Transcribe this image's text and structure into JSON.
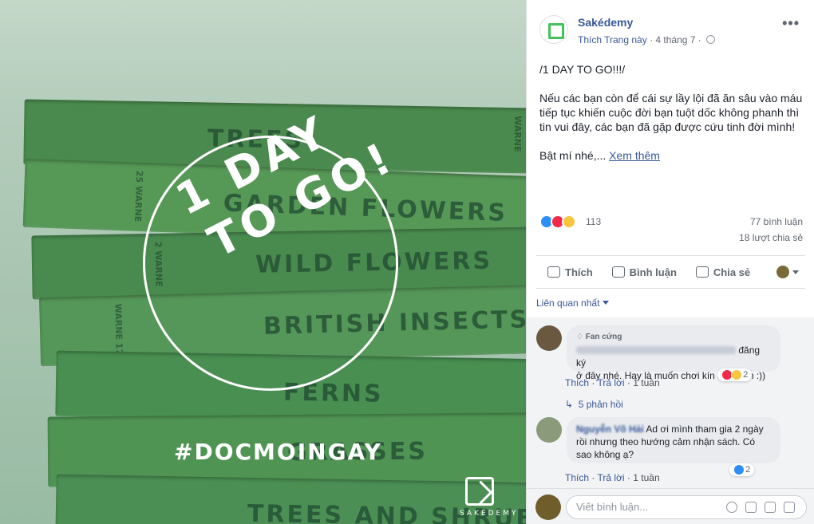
{
  "image": {
    "titles": [
      "TREES",
      "GARDEN FLOWERS",
      "WILD FLOWERS",
      "BRITISH INSECTS",
      "FERNS",
      "GRASSES",
      "TREES AND SHRUBS"
    ],
    "spine_text": [
      "WARNE",
      "25 WARNE",
      "2 WARNE",
      "WARNE 17"
    ],
    "headline_line1": "1 DAY",
    "headline_line2": "TO GO!",
    "hashtag": "#DOCMOINGAY",
    "brand": "SAKÉDEMY"
  },
  "post": {
    "page_name": "Sakédemy",
    "like_page": "Thích Trang này",
    "separator": "·",
    "date": "4 tháng 7",
    "separator2": "·",
    "more": "•••",
    "lines": [
      "/1 DAY TO GO!!!/",
      "Nếu các bạn còn để cái sự lầy lội đã ăn sâu vào máu tiếp tục khiến cuộc đời bạn tuột dốc không phanh thì tin vui đây, các bạn đã gặp được cứu tinh đời mình!",
      "Bật mí nhé,..."
    ],
    "see_more": "Xem thêm"
  },
  "stats": {
    "reactions": "113",
    "comments": "77 bình luận",
    "shares": "18 lượt chia sẻ"
  },
  "actions": {
    "like": "Thích",
    "comment": "Bình luận",
    "share": "Chia sẻ"
  },
  "sort": "Liên quan nhất",
  "comments": [
    {
      "badge": "Fan cứng",
      "text_a": "đăng ký",
      "text_b": "ở đây nhé. Hay là muốn chơi kín 3 chị em :))",
      "like": "Thích",
      "dot": "·",
      "reply": "Trả lời",
      "time": "1 tuần",
      "reactions": "2",
      "replies": "5 phản hồi"
    },
    {
      "author": "Nguyễn Võ Hải",
      "text": "Ad ơi mình tham gia 2 ngày rồi nhưng theo hướng cảm nhận sách. Có sao không ạ?",
      "like": "Thích",
      "dot": "·",
      "reply": "Trả lời",
      "time": "1 tuần",
      "reactions": "2"
    }
  ],
  "composer": {
    "placeholder": "Viết bình luận..."
  },
  "colors": {
    "link": "#365899",
    "like_blue": "#2e8ef8",
    "love_red": "#f0284a",
    "haha_yellow": "#f7c53e",
    "book_green": "#4f8f55"
  }
}
